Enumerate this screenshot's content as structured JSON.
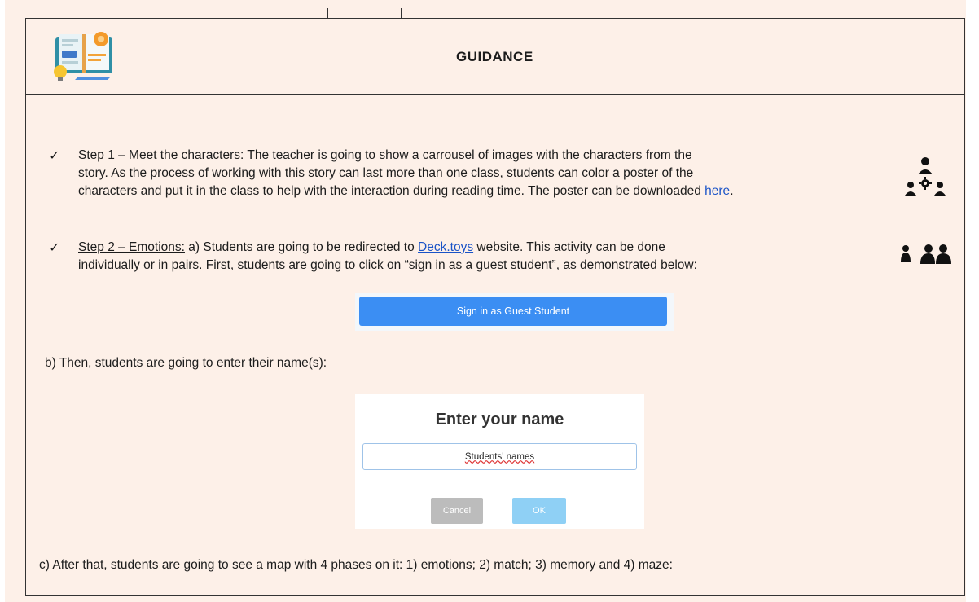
{
  "header": {
    "title": "GUIDANCE"
  },
  "step1": {
    "check": "✓",
    "title": "Step 1 – Meet the characters",
    "colon": ":",
    "line1": " The teacher is going to show a carrousel of images with the characters from the",
    "line2": "story. As the process of working with this story can last more than one class, students can color a poster of the",
    "line3_before": "characters and put it in the class to help with the interaction during reading time. The poster can be downloaded ",
    "link": "here",
    "line3_after": "."
  },
  "step2": {
    "check": "✓",
    "title": "Step 2 – Emotions:",
    "line1_before": " a) Students are going to be redirected to ",
    "link": "Deck.toys",
    "line1_after": " website. This activity can be done",
    "line2": "individually or in pairs. First, students are going to click on “sign in as a guest student”, as demonstrated below:"
  },
  "guest_button": {
    "label": "Sign in as Guest Student"
  },
  "step_b": {
    "text": "b) Then, students are going to enter their name(s):"
  },
  "name_dialog": {
    "title": "Enter your name",
    "input_value": "Students' names",
    "cancel_label": "Cancel",
    "ok_label": "OK"
  },
  "step_c": {
    "text": "c) After that, students are going to see a map with 4 phases on it: 1) emotions; 2) match; 3) memory and 4) maze:"
  },
  "colors": {
    "background": "#fdf0e8",
    "link": "#1a53c7",
    "guest_button": "#3b8ef3",
    "ok_button": "#8fd0f5",
    "cancel_button": "#bcbcbc"
  },
  "icons": [
    "book-lightbulb-logo-icon",
    "team-group-icon",
    "individual-icon",
    "pair-icon"
  ]
}
